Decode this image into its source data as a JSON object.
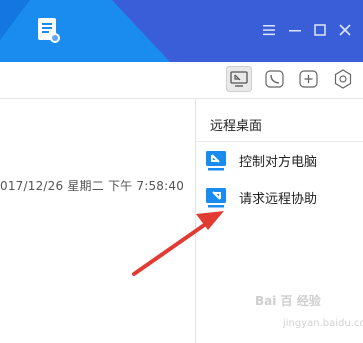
{
  "colors": {
    "titlebar_blue": "#1a8cf0",
    "titlebar_dark": "#3a5ed8",
    "accent_red": "#e23b34",
    "icon_blue": "#1a8cf0"
  },
  "titlebar": {
    "app_icon": "document-icon",
    "controls": [
      "menu-icon",
      "minimize-icon",
      "maximize-icon",
      "close-icon"
    ]
  },
  "toolbar": {
    "buttons": [
      "screen-share-icon",
      "phone-icon",
      "add-icon",
      "settings-icon"
    ]
  },
  "chat": {
    "timestamp": "017/12/26 星期二 下午 7:58:40"
  },
  "panel": {
    "title": "远程桌面",
    "items": [
      {
        "label": "控制对方电脑",
        "icon": "remote-control-icon"
      },
      {
        "label": "请求远程协助",
        "icon": "request-assist-icon"
      }
    ]
  },
  "watermark": {
    "text": "Bai 百 经验",
    "sub": "jingyan.baidu.com"
  }
}
